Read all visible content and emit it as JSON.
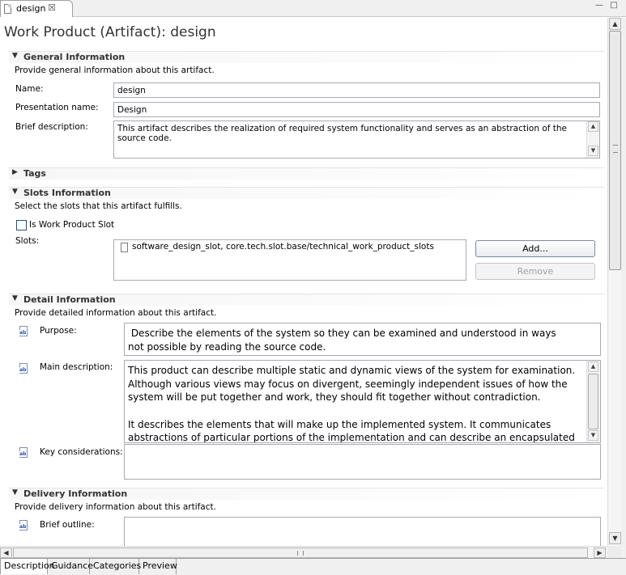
{
  "editor_tab": {
    "label": "design",
    "close": "☒"
  },
  "window_controls": {
    "minimize": "—",
    "maximize": "□"
  },
  "title": "Work Product (Artifact): design",
  "general": {
    "title": "General Information",
    "description": "Provide general information about this artifact.",
    "name_label": "Name:",
    "name_value": "design",
    "presentation_label": "Presentation name:",
    "presentation_value": "Design",
    "brief_label": "Brief description:",
    "brief_value": "This artifact describes the realization of required system functionality and serves as an abstraction of the source code."
  },
  "tags": {
    "title": "Tags"
  },
  "slots": {
    "title": "Slots Information",
    "description": "Select the slots that this artifact fulfills.",
    "checkbox_label": "Is Work Product Slot",
    "checkbox_checked": false,
    "slots_label": "Slots:",
    "items": [
      "software_design_slot, core.tech.slot.base/technical_work_product_slots"
    ],
    "add_button": "Add...",
    "remove_button": "Remove"
  },
  "detail": {
    "title": "Detail Information",
    "description": "Provide detailed information about this artifact.",
    "purpose_label": "Purpose:",
    "purpose_line1": " Describe the elements of the system so they can be examined and understood in ways",
    "purpose_line2": "not possible by reading the source code.",
    "main_label": "Main description:",
    "main_p1": "This product can describe multiple static and dynamic views of the system for examination. Although various views may focus on divergent, seemingly independent issues of how the system will be put together and work, they should fit together without contradiction.",
    "main_p2": "It describes the elements that will make up the implemented system. It communicates abstractions of particular portions of the implementation and can describe an encapsulated",
    "key_label": "Key considerations:",
    "key_value": ""
  },
  "delivery": {
    "title": "Delivery Information",
    "description": "Provide delivery information about this artifact.",
    "outline_label": "Brief outline:",
    "outline_value": ""
  },
  "bottom_tabs": [
    "Description",
    "Guidance",
    "Categories",
    "Preview"
  ],
  "icons": {
    "expanded": "▼",
    "collapsed": "▶",
    "up": "▲",
    "down": "▼",
    "left": "◀",
    "right": "▶"
  },
  "colors": {
    "section_title": "#333333",
    "field_border": "#a5acb5",
    "accent": "#1c5180"
  }
}
